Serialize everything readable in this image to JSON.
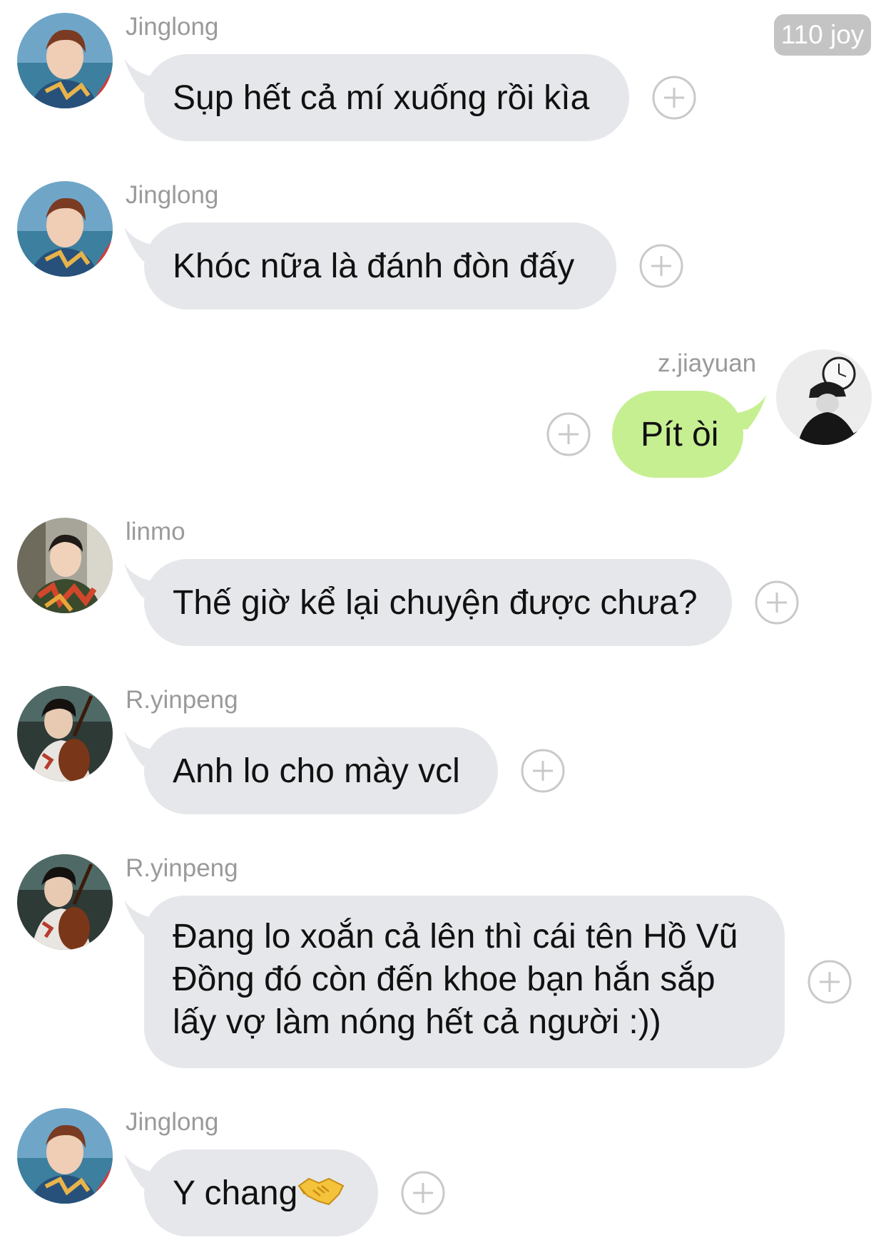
{
  "header": {
    "badge": "110 joy"
  },
  "colors": {
    "bubble_received": "#e5e7ea",
    "bubble_sent": "#c6ef92",
    "username": "#9a9a9a",
    "badge_bg": "#c4c4c4"
  },
  "messages": [
    {
      "sender": "Jinglong",
      "text": "Sụp hết cả mí xuống rồi kìa",
      "side": "left",
      "avatar": "jinglong-avatar"
    },
    {
      "sender": "Jinglong",
      "text": "Khóc nữa là đánh đòn đấy",
      "side": "left",
      "avatar": "jinglong-avatar"
    },
    {
      "sender": "z.jiayuan",
      "text": "Pít òi",
      "side": "right",
      "avatar": "zjiayuan-avatar"
    },
    {
      "sender": "linmo",
      "text": "Thế giờ kể lại chuyện được chưa?",
      "side": "left",
      "avatar": "linmo-avatar"
    },
    {
      "sender": "R.yinpeng",
      "text": "Anh lo cho mày vcl",
      "side": "left",
      "avatar": "ryinpeng-avatar"
    },
    {
      "sender": "R.yinpeng",
      "lines": [
        "Đang lo xoắn cả lên thì cái tên Hồ Vũ",
        "Đồng đó còn đến khoe bạn hắn sắp",
        "lấy vợ làm nóng hết cả người :))"
      ],
      "side": "left",
      "avatar": "ryinpeng-avatar"
    },
    {
      "sender": "Jinglong",
      "text": "Y chang",
      "emoji": "handshake-emoji",
      "side": "left",
      "avatar": "jinglong-avatar"
    }
  ]
}
